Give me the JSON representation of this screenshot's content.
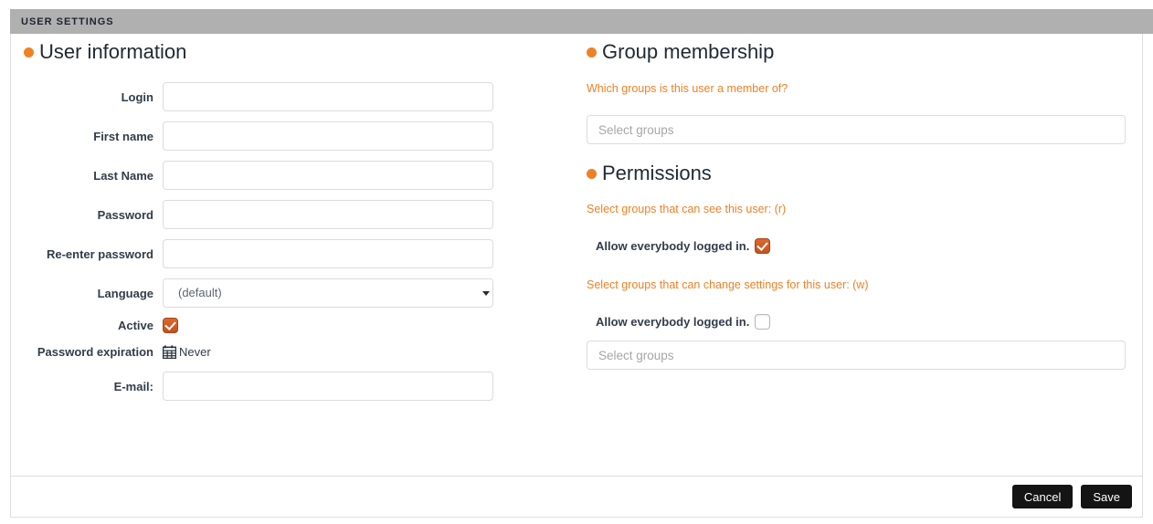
{
  "window": {
    "title": "USER SETTINGS"
  },
  "user_information": {
    "heading": "User information",
    "fields": [
      {
        "label": "Login",
        "value": "",
        "placeholder": ""
      },
      {
        "label": "First name",
        "value": "",
        "placeholder": ""
      },
      {
        "label": "Last Name",
        "value": "",
        "placeholder": ""
      },
      {
        "label": "Password",
        "value": "",
        "placeholder": ""
      },
      {
        "label": "Re-enter password",
        "value": "",
        "placeholder": ""
      }
    ],
    "language": {
      "label": "Language",
      "selected": "(default)"
    },
    "active": {
      "label": "Active",
      "checked": true
    },
    "password_expiration": {
      "label": "Password expiration",
      "icon": "calendar-icon",
      "value": "Never"
    },
    "email": {
      "label": "E-mail:",
      "value": "",
      "placeholder": ""
    }
  },
  "group_membership": {
    "heading": "Group membership",
    "hint": "Which groups is this user a member of?",
    "select_placeholder": "Select groups",
    "select_value": ""
  },
  "permissions": {
    "heading": "Permissions",
    "read_hint": "Select groups that can see this user: (r)",
    "read_allow_label": "Allow everybody logged in.",
    "read_allow_checked": true,
    "write_hint": "Select groups that can change settings for this user: (w)",
    "write_allow_label": "Allow everybody logged in.",
    "write_allow_checked": false,
    "select_placeholder": "Select groups",
    "select_value": ""
  },
  "footer": {
    "cancel_label": "Cancel",
    "save_label": "Save"
  },
  "colors": {
    "accent": "#ef8125",
    "checkbox_on": "#c4521f",
    "titlebar": "#b0b0b0",
    "button": "#141414"
  }
}
